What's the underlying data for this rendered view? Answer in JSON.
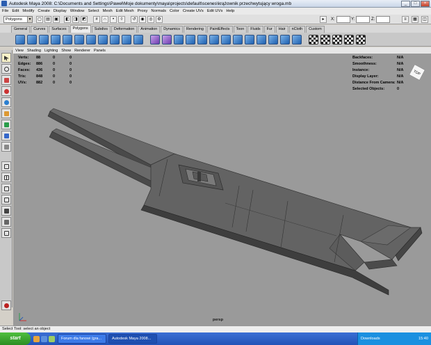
{
  "window": {
    "title": "Autodesk Maya 2008: C:\\Documents and Settings\\Paweł\\Moje dokumenty\\maya\\projects\\default\\scenes\\krążownik przechwytujący wroga.mb"
  },
  "menu": [
    "File",
    "Edit",
    "Modify",
    "Create",
    "Display",
    "Window",
    "Select",
    "Mesh",
    "Edit Mesh",
    "Proxy",
    "Normals",
    "Color",
    "Create UVs",
    "Edit UVs",
    "Help"
  ],
  "status_line": {
    "mode": "Polygons",
    "x_label": "X:",
    "y_label": "Y:",
    "z_label": "Z:"
  },
  "shelf": {
    "tabs": [
      "General",
      "Curves",
      "Surfaces",
      "Polygons",
      "Subdivs",
      "Deformation",
      "Animation",
      "Dynamics",
      "Rendering",
      "PaintEffects",
      "Toon",
      "Fluids",
      "Fur",
      "Hair",
      "nCloth",
      "Custom"
    ],
    "active_tab": "Polygons"
  },
  "panel_menu": [
    "View",
    "Shading",
    "Lighting",
    "Show",
    "Renderer",
    "Panels"
  ],
  "hud_left": [
    {
      "label": "Verts:",
      "v1": "88",
      "v2": "0",
      "v3": "0"
    },
    {
      "label": "Edges:",
      "v1": "886",
      "v2": "0",
      "v3": "0"
    },
    {
      "label": "Faces:",
      "v1": "436",
      "v2": "0",
      "v3": "0"
    },
    {
      "label": "Tris:",
      "v1": "848",
      "v2": "0",
      "v3": "0"
    },
    {
      "label": "UVs:",
      "v1": "882",
      "v2": "0",
      "v3": "0"
    }
  ],
  "hud_right": [
    {
      "label": "Backfaces:",
      "value": "N/A"
    },
    {
      "label": "Smoothness:",
      "value": "N/A"
    },
    {
      "label": "Instance:",
      "value": "N/A"
    },
    {
      "label": "Display Layer:",
      "value": "N/A"
    },
    {
      "label": "Distance From Camera:",
      "value": "N/A"
    },
    {
      "label": "Selected Objects:",
      "value": "0"
    }
  ],
  "viewport": {
    "camera_label": "persp",
    "viewcube_label": "TOP"
  },
  "status_bar": {
    "help_text": "Select Tool: select an object"
  },
  "taskbar": {
    "start_label": "start",
    "tasks": [
      {
        "label": "Forum dla fanowi (gra..."
      },
      {
        "label": "Autodesk Maya 2008..."
      }
    ],
    "tray_label": "Downloads",
    "clock": "15:40"
  },
  "colors": {
    "viewport_bg": "#9a9a9a",
    "model_face": "#5e5e5e",
    "taskbar": "#2253b8"
  }
}
